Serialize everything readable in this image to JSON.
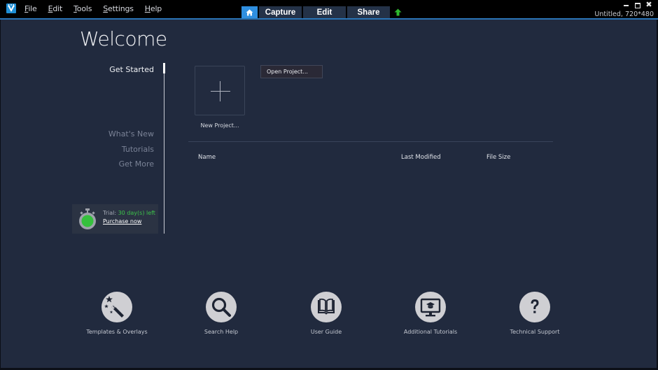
{
  "titlebar": {
    "menu": [
      {
        "label": "File",
        "accel": "F",
        "rest": "ile"
      },
      {
        "label": "Edit",
        "accel": "E",
        "rest": "dit"
      },
      {
        "label": "Tools",
        "accel": "T",
        "rest": "ools"
      },
      {
        "label": "Settings",
        "accel": "S",
        "rest": "ettings"
      },
      {
        "label": "Help",
        "accel": "H",
        "rest": "elp"
      }
    ],
    "mode_tabs": {
      "home_icon": "home-icon",
      "capture": "Capture",
      "edit": "Edit",
      "share": "Share",
      "upgrade_icon": "upgrade-arrow-icon"
    },
    "window_controls": {
      "minimize": "–",
      "maximize": "□",
      "close": "✖"
    },
    "project_info": "Untitled, 720*480",
    "accent_color": "#2a74b6"
  },
  "welcome": {
    "title": "Welcome",
    "side_nav": [
      {
        "label": "Get Started",
        "active": true
      },
      {
        "label": "What's New",
        "active": false
      },
      {
        "label": "Tutorials",
        "active": false
      },
      {
        "label": "Get More",
        "active": false
      }
    ],
    "trial": {
      "prefix": "Trial: ",
      "days": "30 day(s) left",
      "purchase_label": "Purchase now",
      "status_color": "#3cc24a"
    }
  },
  "projects": {
    "new_project_label": "New Project...",
    "open_project_label": "Open Project...",
    "columns": [
      "Name",
      "Last Modified",
      "File Size"
    ],
    "rows": []
  },
  "shortcuts": [
    {
      "label": "Templates & Overlays",
      "icon": "magic-wand-icon"
    },
    {
      "label": "Search Help",
      "icon": "magnifier-icon"
    },
    {
      "label": "User Guide",
      "icon": "open-book-icon"
    },
    {
      "label": "Additional Tutorials",
      "icon": "monitor-graduation-cap-icon"
    },
    {
      "label": "Technical Support",
      "icon": "question-mark-icon"
    }
  ]
}
